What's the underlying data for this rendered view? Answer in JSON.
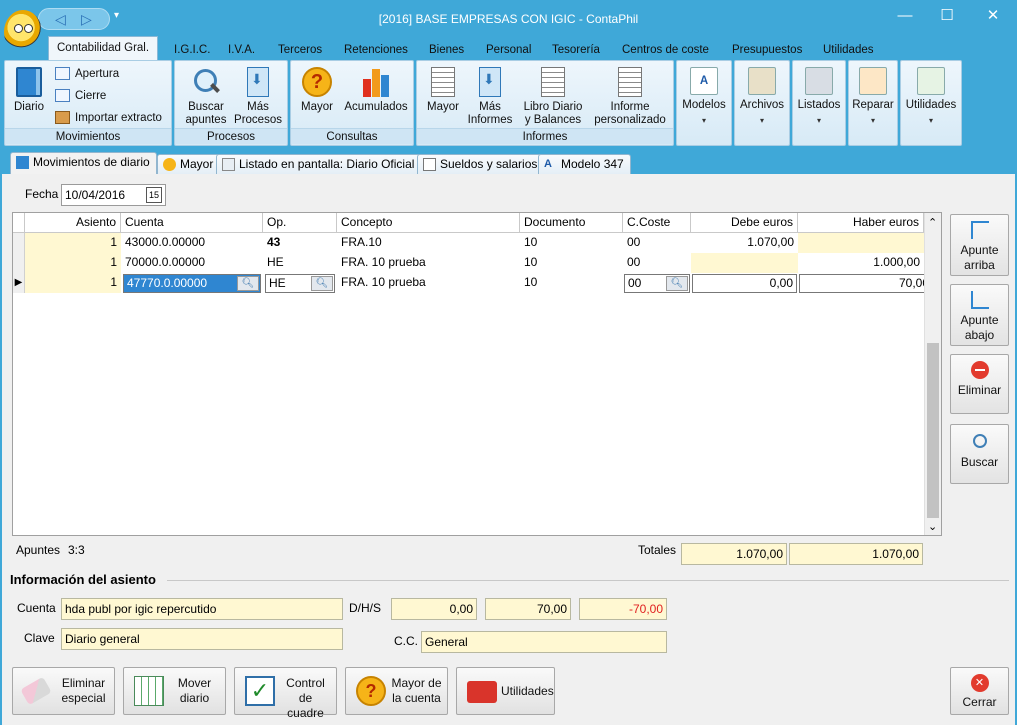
{
  "window": {
    "title": "[2016] BASE EMPRESAS CON IGIC - ContaPhil",
    "minimize": "—",
    "maximize": "☐",
    "close": "✕"
  },
  "qat": {
    "back": "◁",
    "forward": "▷",
    "more": "▾"
  },
  "ribbon_tabs": [
    "Contabilidad Gral.",
    "I.G.I.C.",
    "I.V.A.",
    "Terceros",
    "Retenciones",
    "Bienes",
    "Personal",
    "Tesorería",
    "Centros de coste",
    "Presupuestos",
    "Utilidades"
  ],
  "ribbon": {
    "movimientos": {
      "label": "Movimientos",
      "diario": "Diario",
      "apertura": "Apertura",
      "cierre": "Cierre",
      "importar": "Importar extracto"
    },
    "procesos": {
      "label": "Procesos",
      "buscar_line1": "Buscar",
      "buscar_line2": "apuntes",
      "mas_line1": "Más",
      "mas_line2": "Procesos"
    },
    "consultas": {
      "label": "Consultas",
      "mayor": "Mayor",
      "acumulados": "Acumulados"
    },
    "informes": {
      "label": "Informes",
      "mayor": "Mayor",
      "mas_line1": "Más",
      "mas_line2": "Informes",
      "libro_line1": "Libro Diario",
      "libro_line2": "y Balances",
      "informe_line1": "Informe",
      "informe_line2": "personalizado"
    },
    "modelos": "Modelos",
    "archivos": "Archivos",
    "listados": "Listados",
    "reparar": "Reparar",
    "utilidades": "Utilidades",
    "dropdown": "▾"
  },
  "doc_tabs": [
    "Movimientos de diario",
    "Mayor",
    "Listado en pantalla: Diario Oficial",
    "Sueldos y salarios",
    "Modelo 347"
  ],
  "fecha": {
    "label": "Fecha",
    "value": "10/04/2016",
    "cal": "15"
  },
  "grid": {
    "headers": [
      "Asiento",
      "Cuenta",
      "Op.",
      "Concepto",
      "Documento",
      "C.Coste",
      "Debe euros",
      "Haber euros"
    ],
    "rows": [
      {
        "asiento": "1",
        "cuenta": "43000.0.00000",
        "op": "43",
        "concepto": "FRA.10",
        "documento": "10",
        "ccoste": "00",
        "debe": "1.070,00",
        "haber": ""
      },
      {
        "asiento": "1",
        "cuenta": "70000.0.00000",
        "op": "HE",
        "concepto": "FRA. 10 prueba",
        "documento": "10",
        "ccoste": "00",
        "debe": "",
        "haber": "1.000,00"
      },
      {
        "asiento": "1",
        "cuenta": "47770.0.00000",
        "op": "HE",
        "concepto": "FRA. 10 prueba",
        "documento": "10",
        "ccoste": "00",
        "debe": "0,00",
        "haber": "70,00"
      }
    ],
    "scroll_up": "⌃",
    "scroll_down": "⌄"
  },
  "side_buttons": {
    "apunte_arriba_1": "Apunte",
    "apunte_arriba_2": "arriba",
    "apunte_abajo_1": "Apunte",
    "apunte_abajo_2": "abajo",
    "eliminar": "Eliminar",
    "buscar": "Buscar"
  },
  "apuntes": {
    "label": "Apuntes",
    "value": "3:3"
  },
  "totales": {
    "label": "Totales",
    "debe": "1.070,00",
    "haber": "1.070,00"
  },
  "info": {
    "heading": "Información del asiento",
    "cuenta_label": "Cuenta",
    "cuenta_value": "hda publ por igic repercutido",
    "dhs_label": "D/H/S",
    "d": "0,00",
    "h": "70,00",
    "s": "-70,00",
    "s_color": "#e02020",
    "clave_label": "Clave",
    "clave_value": "Diario general",
    "cc_label": "C.C.",
    "cc_value": "General"
  },
  "bottom_buttons": {
    "eliminar_1": "Eliminar",
    "eliminar_2": "especial",
    "mover_1": "Mover",
    "mover_2": "diario",
    "control_1": "Control",
    "control_2": "de cuadre",
    "mayor_1": "Mayor de",
    "mayor_2": "la cuenta",
    "utilidades": "Utilidades",
    "cerrar": "Cerrar"
  }
}
